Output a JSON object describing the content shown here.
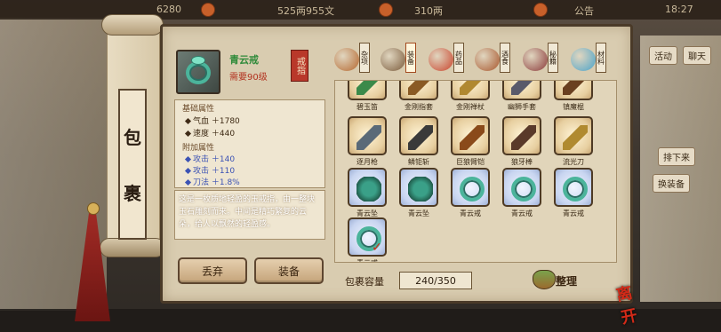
{
  "hud": {
    "silver": "6280",
    "currency": "525两955文",
    "gold": "310两",
    "announcement": "公告",
    "time": "18:27"
  },
  "scroll": {
    "char1": "包",
    "char2": "裹"
  },
  "item": {
    "name": "青云戒",
    "requirement": "需要90级",
    "type_tag": "戒指",
    "base_header": "基础属性",
    "base_attrs": [
      "气血 ＋1780",
      "速度 ＋440"
    ],
    "extra_header": "附加属性",
    "extra_attrs": [
      "攻击 ＋140",
      "攻击 ＋110",
      "刀法 ＋1.8%"
    ],
    "description": "这是一枚质地轻盈的玉戒指，由一整块玉石雕刻而来。中间是精巧繁复的云朵，给人以飘然的轻盈感。"
  },
  "actions": {
    "discard": "丢弃",
    "equip": "装备"
  },
  "tabs": [
    {
      "label": "杂项",
      "icon": "bag-icon",
      "color": "#b5672e"
    },
    {
      "label": "装备",
      "icon": "weapon-icon",
      "color": "#7a5a3a"
    },
    {
      "label": "药品",
      "icon": "medicine-icon",
      "color": "#c9432b"
    },
    {
      "label": "酒食",
      "icon": "wine-icon",
      "color": "#a8562c"
    },
    {
      "label": "秘籍",
      "icon": "book-icon",
      "color": "#8b3a3a"
    },
    {
      "label": "材料",
      "icon": "crystal-icon",
      "color": "#4aa3c9"
    }
  ],
  "grid_rows": [
    {
      "items": [
        {
          "name": "碧玉笛",
          "icon": "flute-icon",
          "color": "#3b8a4a"
        },
        {
          "name": "金刚指套",
          "icon": "gauntlet-icon",
          "color": "#8a5a24"
        },
        {
          "name": "金刚禅杖",
          "icon": "staff-icon",
          "color": "#b08830"
        },
        {
          "name": "幽狮手套",
          "icon": "glove-icon",
          "color": "#5a5a6a"
        },
        {
          "name": "镇魔棍",
          "icon": "club-icon",
          "color": "#6a4020"
        }
      ]
    },
    {
      "items": [
        {
          "name": "逐月枪",
          "icon": "spear-icon",
          "color": "#5a6a78"
        },
        {
          "name": "鳞钜斩",
          "icon": "axe-icon",
          "color": "#3a3a3a"
        },
        {
          "name": "巨狼臂铠",
          "icon": "armguard-icon",
          "color": "#8a4a1a"
        },
        {
          "name": "狼牙棒",
          "icon": "mace-icon",
          "color": "#5a3a2a"
        },
        {
          "name": "流光刀",
          "icon": "blade-icon",
          "color": "#b08a30"
        }
      ]
    },
    {
      "items": [
        {
          "name": "青云坠",
          "icon": "pendant-icon",
          "color": "#3aa088"
        },
        {
          "name": "青云坠",
          "icon": "pendant-icon",
          "color": "#3aa088"
        },
        {
          "name": "青云戒",
          "icon": "ring-icon",
          "color": "#4bb49b"
        },
        {
          "name": "青云戒",
          "icon": "ring-icon",
          "color": "#4bb49b"
        },
        {
          "name": "青云戒",
          "icon": "ring-icon",
          "color": "#4bb49b"
        }
      ]
    },
    {
      "items": [
        {
          "name": "青云戒",
          "icon": "ring-icon",
          "color": "#4bb49b",
          "selected": true
        }
      ]
    }
  ],
  "capacity": {
    "label": "包裹容量",
    "value": "240/350"
  },
  "sort_label": "整理",
  "close_label": "离开",
  "right_panel": {
    "btn1": "活动",
    "btn2": "聊天",
    "btn3": "排下来",
    "btn4": "换装备"
  },
  "colors": {
    "panel": "#d9ccb0",
    "frame": "#4a3a28",
    "accent_red": "#b9382a",
    "green_name": "#2f8a3a"
  }
}
